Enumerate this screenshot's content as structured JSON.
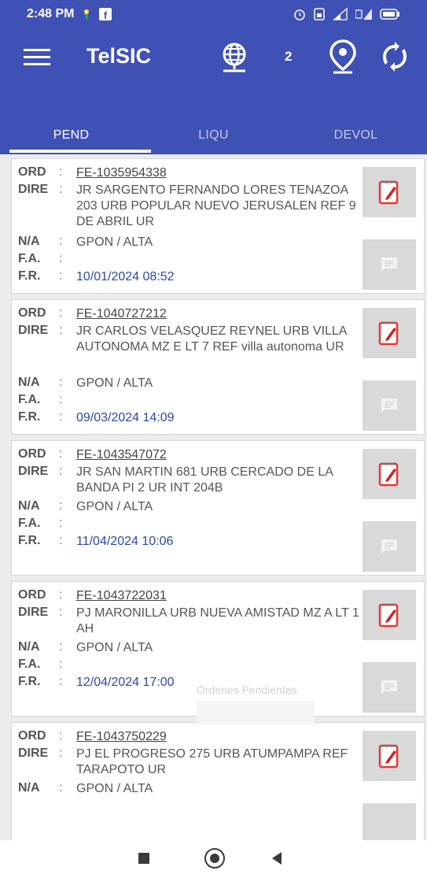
{
  "status_bar": {
    "time": "2:48 PM"
  },
  "app_bar": {
    "title": "TelSIC",
    "badge_count": "2"
  },
  "tabs": [
    {
      "label": "PEND",
      "active": true
    },
    {
      "label": "LIQU",
      "active": false
    },
    {
      "label": "DEVOL",
      "active": false
    }
  ],
  "labels": {
    "ord": "ORD",
    "dire": "DIRE",
    "na": "N/A",
    "fa": "F.A.",
    "fr": "F.R.",
    "sep": ":"
  },
  "orders": [
    {
      "ord": "FE-1035954338",
      "dire": "JR SARGENTO FERNANDO LORES TENAZOA 203 URB POPULAR NUEVO JERUSALEN REF 9 DE ABRIL UR",
      "na": "GPON / ALTA",
      "fa": "",
      "fr": "10/01/2024 08:52"
    },
    {
      "ord": "FE-1040727212",
      "dire": "JR CARLOS VELASQUEZ REYNEL URB VILLA AUTONOMA MZ E LT 7 REF villa autonoma UR",
      "na": "GPON / ALTA",
      "fa": "",
      "fr": "09/03/2024 14:09"
    },
    {
      "ord": "FE-1043547072",
      "dire": "JR SAN MARTIN 681 URB CERCADO DE LA BANDA PI 2 UR INT 204B",
      "na": "GPON / ALTA",
      "fa": "",
      "fr": "11/04/2024 10:06"
    },
    {
      "ord": "FE-1043722031",
      "dire": "PJ MARONILLA URB NUEVA AMISTAD MZ A LT 1 AH",
      "na": "GPON / ALTA",
      "fa": "",
      "fr": "12/04/2024 17:00"
    },
    {
      "ord": "FE-1043750229",
      "dire": "PJ EL PROGRESO 275 URB ATUMPAMPA REF TARAPOTO UR",
      "na": "GPON / ALTA",
      "fa": "",
      "fr": ""
    }
  ],
  "toast": {
    "text": "Ordenes Pendientes"
  },
  "colors": {
    "primary": "#3f51b5",
    "date": "#2e47a8",
    "button_bg": "#d9d9d9",
    "edit_icon_red": "#e53935"
  },
  "icons": [
    "menu-icon",
    "globe-icon",
    "location-pin-icon",
    "sync-icon",
    "edit-document-icon",
    "message-icon"
  ]
}
